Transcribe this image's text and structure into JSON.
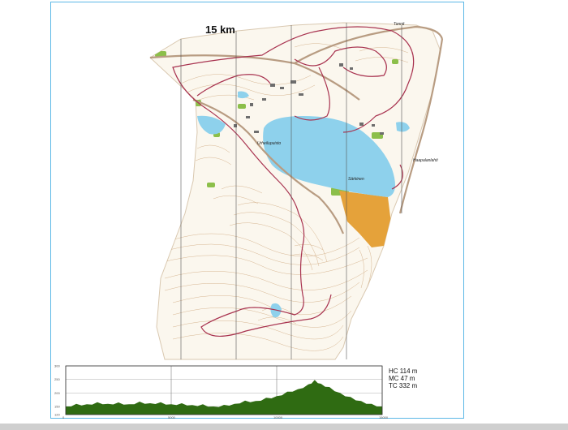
{
  "map": {
    "title": "15 km",
    "labels": {
      "tonnit": "Tonnit",
      "urheilu": "Urheilupuisto",
      "haapalan": "Haapalanlahti",
      "sarkinen": "Särkinen"
    },
    "colors": {
      "water": "#8ed1ec",
      "terrain": "#fbf7ee",
      "contour": "#c79a6a",
      "course": "#a8324f",
      "road": "#b89c82",
      "vegetation": "#8cbf4a",
      "orange_area": "#e5a23a",
      "grid": "#555555"
    }
  },
  "profile": {
    "stats": {
      "hc": "HC 114 m",
      "mc": "MC 47 m",
      "tc": "TC 332 m"
    },
    "y_ticks": [
      "300",
      "250",
      "200",
      "150",
      "120"
    ],
    "x_ticks": [
      "0",
      "5000",
      "10000",
      "15000"
    ],
    "fill_color": "#2f6b12",
    "series": [
      {
        "x": 0,
        "y": 150
      },
      {
        "x": 500,
        "y": 160
      },
      {
        "x": 1000,
        "y": 158
      },
      {
        "x": 1500,
        "y": 166
      },
      {
        "x": 2000,
        "y": 160
      },
      {
        "x": 2500,
        "y": 165
      },
      {
        "x": 3000,
        "y": 158
      },
      {
        "x": 3500,
        "y": 168
      },
      {
        "x": 4000,
        "y": 162
      },
      {
        "x": 4500,
        "y": 166
      },
      {
        "x": 5000,
        "y": 158
      },
      {
        "x": 5500,
        "y": 162
      },
      {
        "x": 6000,
        "y": 155
      },
      {
        "x": 6500,
        "y": 158
      },
      {
        "x": 7000,
        "y": 150
      },
      {
        "x": 7500,
        "y": 156
      },
      {
        "x": 8000,
        "y": 160
      },
      {
        "x": 8500,
        "y": 172
      },
      {
        "x": 9000,
        "y": 170
      },
      {
        "x": 9500,
        "y": 182
      },
      {
        "x": 10000,
        "y": 188
      },
      {
        "x": 10500,
        "y": 205
      },
      {
        "x": 11000,
        "y": 214
      },
      {
        "x": 11500,
        "y": 232
      },
      {
        "x": 11800,
        "y": 248
      },
      {
        "x": 12100,
        "y": 234
      },
      {
        "x": 12500,
        "y": 222
      },
      {
        "x": 13000,
        "y": 200
      },
      {
        "x": 13500,
        "y": 185
      },
      {
        "x": 14000,
        "y": 170
      },
      {
        "x": 14500,
        "y": 160
      },
      {
        "x": 15000,
        "y": 150
      }
    ]
  }
}
